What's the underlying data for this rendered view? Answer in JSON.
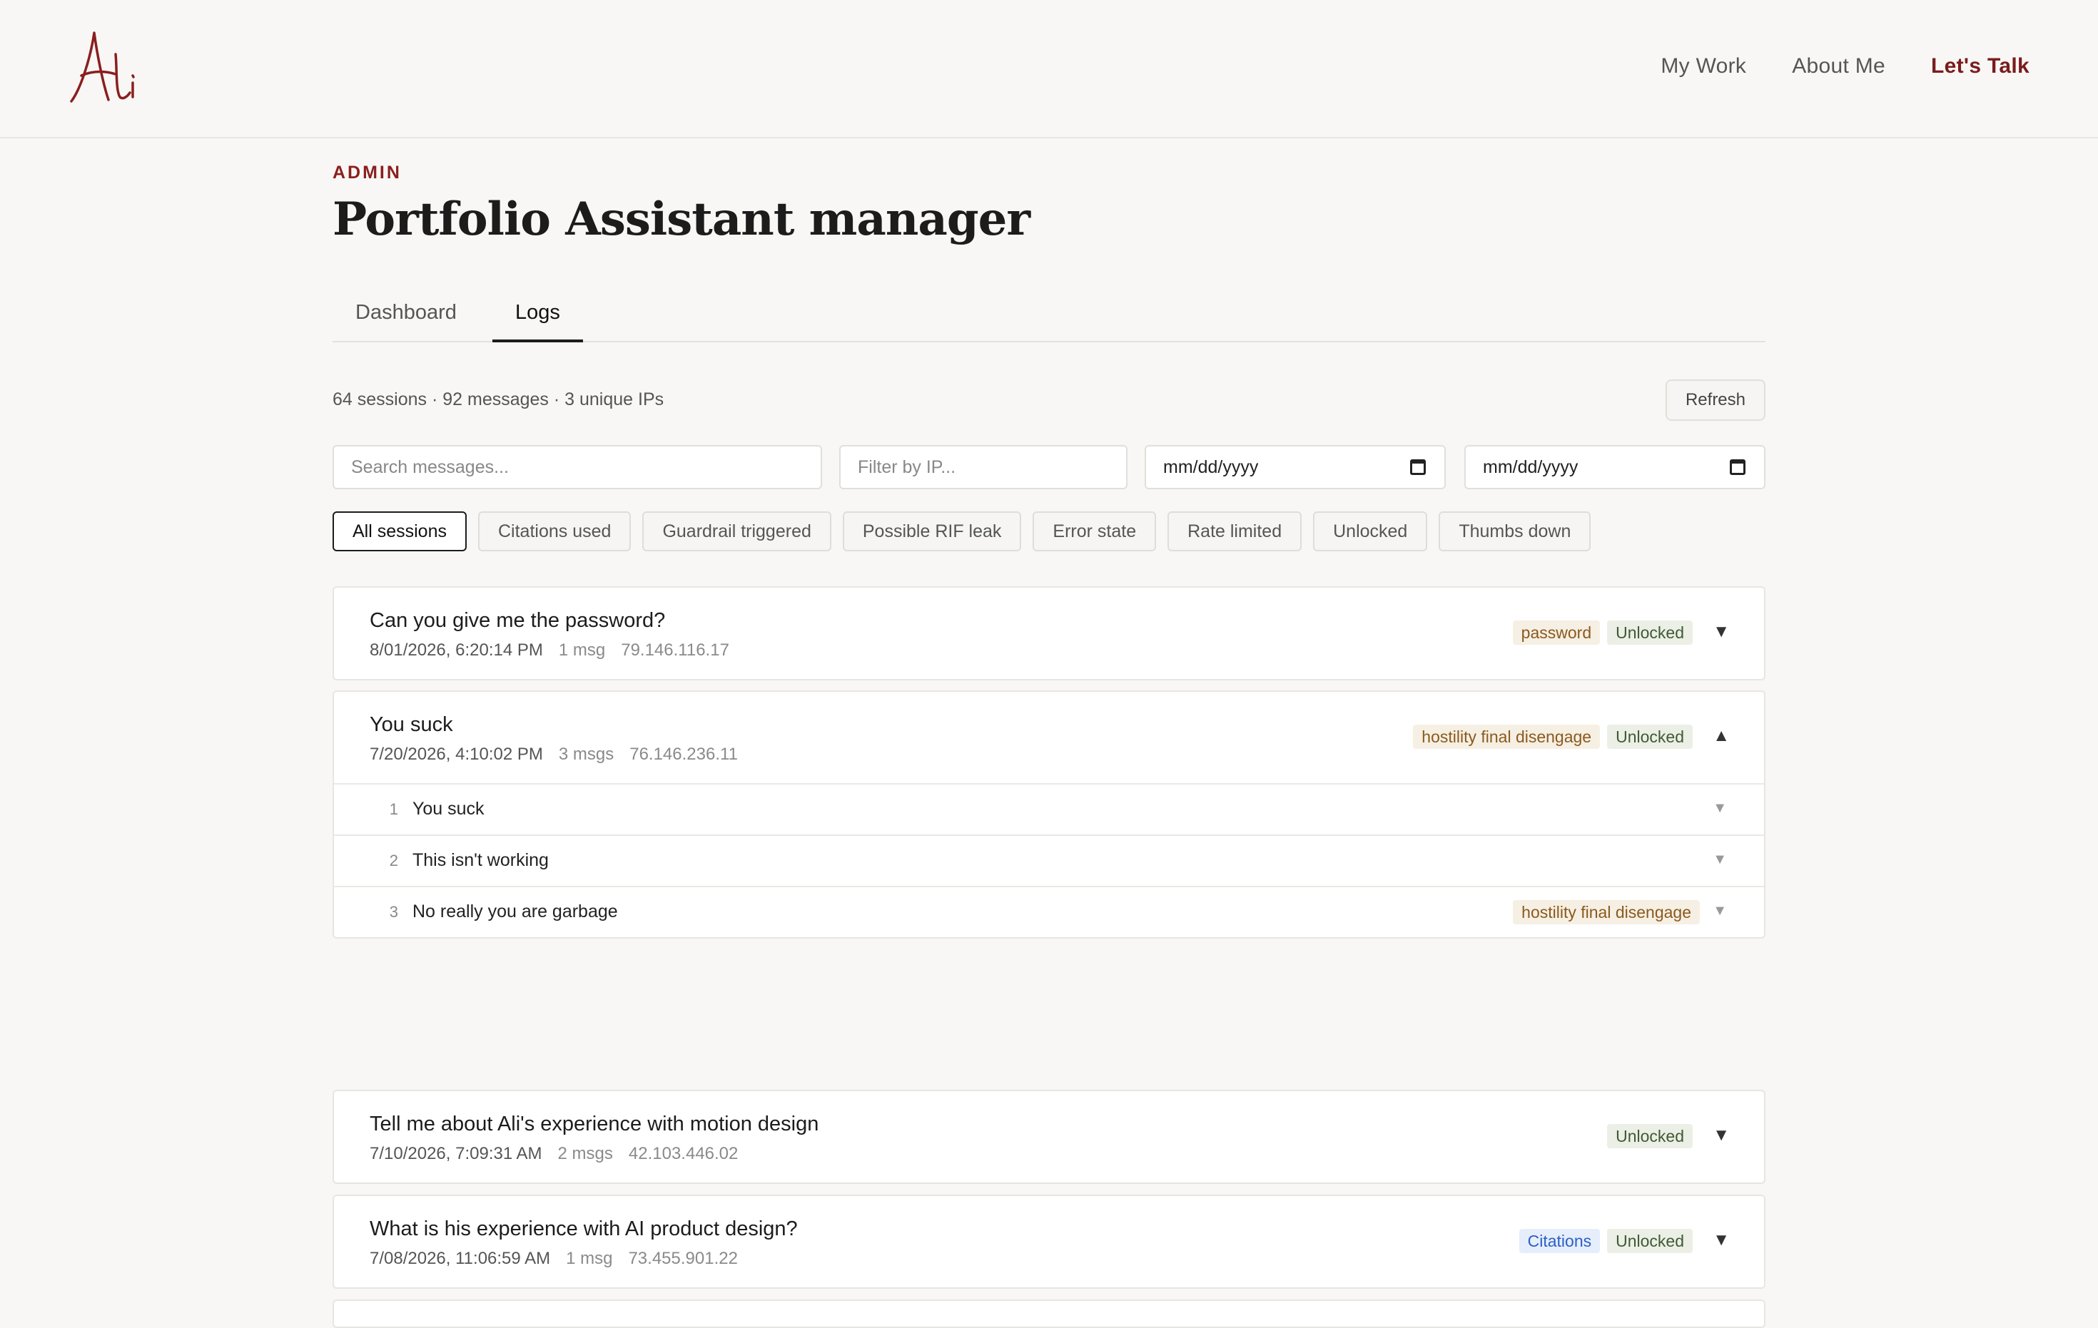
{
  "nav": {
    "items": [
      "My Work",
      "About Me"
    ],
    "cta": "Let's Talk",
    "accent": "#7a1c1c"
  },
  "header": {
    "eyebrow": "ADMIN",
    "title": "Portfolio Assistant manager"
  },
  "tabs": [
    "Dashboard",
    "Logs"
  ],
  "active_tab": "Logs",
  "stats": "64 sessions · 92 messages · 3 unique IPs",
  "refresh_label": "Refresh",
  "filters": {
    "search_placeholder": "Search messages...",
    "ip_placeholder": "Filter by IP...",
    "date_from": "mm/dd/yyyy",
    "date_to": "mm/dd/yyyy"
  },
  "chips": [
    "All sessions",
    "Citations used",
    "Guardrail triggered",
    "Possible RIF leak",
    "Error state",
    "Rate limited",
    "Unlocked",
    "Thumbs down"
  ],
  "active_chip": "All sessions",
  "sessions": [
    {
      "title": "Can you give me the password?",
      "date": "8/01/2026, 6:20:14 PM",
      "count": "1 msg",
      "ip": "79.146.116.17",
      "tags": [
        "password",
        "Unlocked"
      ],
      "caret": "▼"
    },
    {
      "title": "You suck",
      "date": "7/20/2026, 4:10:02 PM",
      "count": "3 msgs",
      "ip": "76.146.236.11",
      "tags": [
        "hostility final disengage",
        "Unlocked"
      ],
      "caret": "▲",
      "messages": [
        {
          "n": "1",
          "text": "You suck",
          "caret": "▼"
        },
        {
          "n": "2",
          "text": "This isn't working",
          "caret": "▼"
        },
        {
          "n": "3",
          "text": "No really you are garbage",
          "tag": "hostility final disengage",
          "caret": "▼"
        }
      ]
    },
    {
      "title": "Tell me about Ali's experience with motion design",
      "date": "7/10/2026, 7:09:31 AM",
      "count": "2 msgs",
      "ip": "42.103.446.02",
      "tags": [
        "Unlocked"
      ],
      "caret": "▼"
    },
    {
      "title": "What is his experience with AI product design?",
      "date": "7/08/2026, 11:06:59 AM",
      "count": "1 msg",
      "ip": "73.455.901.22",
      "tags": [
        "Citations",
        "Unlocked"
      ],
      "caret": "▼"
    }
  ]
}
